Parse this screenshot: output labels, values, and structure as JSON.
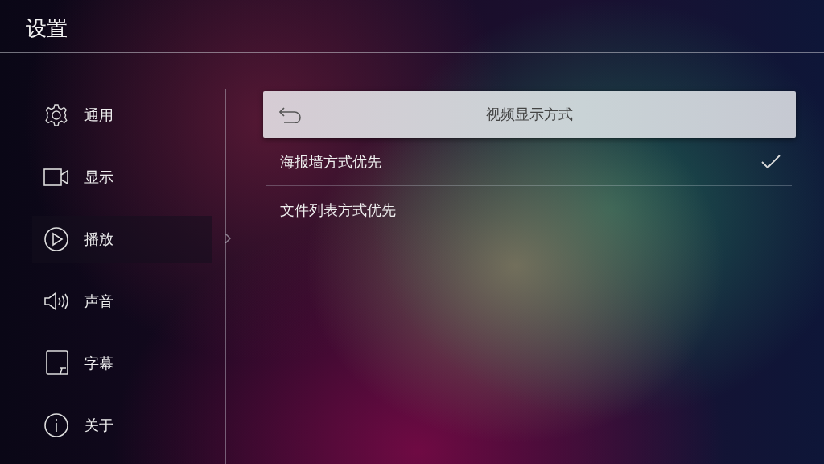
{
  "title": "设置",
  "sidebar": {
    "items": [
      {
        "label": "通用",
        "kind": "gear",
        "selected": false
      },
      {
        "label": "显示",
        "kind": "camera",
        "selected": false
      },
      {
        "label": "播放",
        "kind": "play",
        "selected": true
      },
      {
        "label": "声音",
        "kind": "speaker",
        "selected": false
      },
      {
        "label": "字幕",
        "kind": "subtitle",
        "selected": false
      },
      {
        "label": "关于",
        "kind": "info",
        "selected": false
      }
    ]
  },
  "panel": {
    "title": "视频显示方式",
    "options": [
      {
        "label": "海报墙方式优先",
        "checked": true
      },
      {
        "label": "文件列表方式优先",
        "checked": false
      }
    ]
  }
}
